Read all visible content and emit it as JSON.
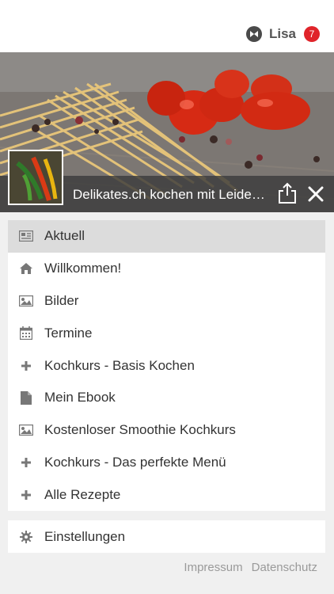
{
  "header": {
    "user_name": "Lisa",
    "notification_count": "7",
    "badge_color": "#e0242a"
  },
  "hero": {
    "title": "Delikates.ch kochen mit Leidenschaft",
    "share_icon": "share-icon",
    "close_icon": "close-icon"
  },
  "menu": {
    "items": [
      {
        "label": "Aktuell",
        "icon": "newspaper-icon",
        "active": true
      },
      {
        "label": "Willkommen!",
        "icon": "home-icon"
      },
      {
        "label": "Bilder",
        "icon": "image-icon"
      },
      {
        "label": "Termine",
        "icon": "calendar-icon"
      },
      {
        "label": "Kochkurs - Basis Kochen",
        "icon": "plus-icon"
      },
      {
        "label": "Mein Ebook",
        "icon": "file-icon"
      },
      {
        "label": "Kostenloser Smoothie Kochkurs",
        "icon": "image-icon"
      },
      {
        "label": "Kochkurs - Das perfekte Menü",
        "icon": "plus-icon"
      },
      {
        "label": "Alle Rezepte",
        "icon": "plus-icon"
      }
    ]
  },
  "settings": {
    "label": "Einstellungen",
    "icon": "gear-icon"
  },
  "footer": {
    "impressum": "Impressum",
    "datenschutz": "Datenschutz"
  }
}
